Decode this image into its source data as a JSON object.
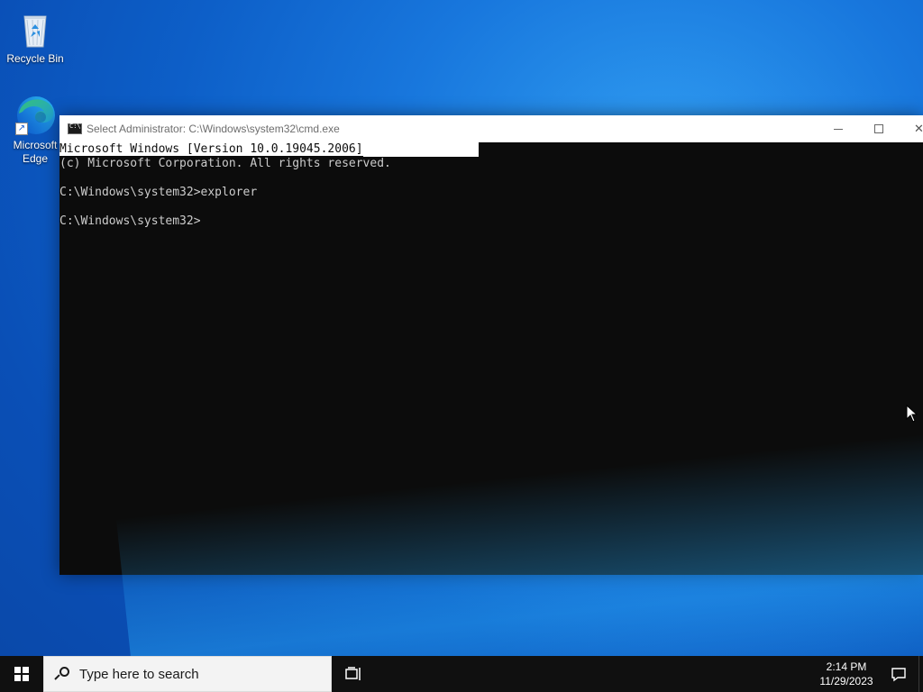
{
  "desktop": {
    "icons": [
      {
        "label": "Recycle Bin",
        "icon": "recycle-bin-icon"
      },
      {
        "label": "Microsoft Edge",
        "label_lines": [
          "Microsoft",
          "Edge"
        ],
        "icon": "edge-icon"
      }
    ]
  },
  "cmd_window": {
    "title": "Select Administrator: C:\\Windows\\system32\\cmd.exe",
    "icon": "cmd-icon",
    "caption_buttons": [
      "minimize-icon",
      "maximize-icon",
      "close-icon"
    ],
    "lines": [
      "Microsoft Windows [Version 10.0.19045.2006]",
      "(c) Microsoft Corporation. All rights reserved.",
      "",
      "C:\\Windows\\system32>explorer",
      "",
      "C:\\Windows\\system32>"
    ],
    "selected_line_index": 0
  },
  "taskbar": {
    "start_icon": "windows-logo-icon",
    "search_placeholder": "Type here to search",
    "task_view_icon": "task-view-icon",
    "clock": {
      "time": "2:14 PM",
      "date": "11/29/2023"
    },
    "notification_icon": "notification-icon"
  }
}
